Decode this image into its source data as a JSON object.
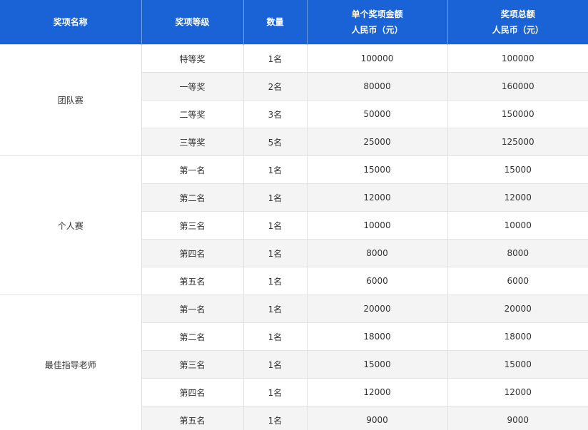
{
  "header": {
    "col1": "奖项名称",
    "col2": "奖项等级",
    "col3": "数量",
    "col4_line1": "单个奖项金额",
    "col4_line2": "人民币（元）",
    "col5_line1": "奖项总额",
    "col5_line2": "人民币（元）"
  },
  "groups": [
    {
      "name": "团队赛",
      "rows": [
        {
          "level": "特等奖",
          "count": "1名",
          "unit": "100000",
          "total": "100000"
        },
        {
          "level": "一等奖",
          "count": "2名",
          "unit": "80000",
          "total": "160000"
        },
        {
          "level": "二等奖",
          "count": "3名",
          "unit": "50000",
          "total": "150000"
        },
        {
          "level": "三等奖",
          "count": "5名",
          "unit": "25000",
          "total": "125000"
        }
      ]
    },
    {
      "name": "个人赛",
      "rows": [
        {
          "level": "第一名",
          "count": "1名",
          "unit": "15000",
          "total": "15000"
        },
        {
          "level": "第二名",
          "count": "1名",
          "unit": "12000",
          "total": "12000"
        },
        {
          "level": "第三名",
          "count": "1名",
          "unit": "10000",
          "total": "10000"
        },
        {
          "level": "第四名",
          "count": "1名",
          "unit": "8000",
          "total": "8000"
        },
        {
          "level": "第五名",
          "count": "1名",
          "unit": "6000",
          "total": "6000"
        }
      ]
    },
    {
      "name": "最佳指导老师",
      "rows": [
        {
          "level": "第一名",
          "count": "1名",
          "unit": "20000",
          "total": "20000"
        },
        {
          "level": "第二名",
          "count": "1名",
          "unit": "18000",
          "total": "18000"
        },
        {
          "level": "第三名",
          "count": "1名",
          "unit": "15000",
          "total": "15000"
        },
        {
          "level": "第四名",
          "count": "1名",
          "unit": "12000",
          "total": "12000"
        },
        {
          "level": "第五名",
          "count": "1名",
          "unit": "9000",
          "total": "9000"
        }
      ]
    }
  ],
  "colors": {
    "header_bg": "#1a63d6",
    "stripe": "#f4f4f4",
    "border": "#e3e3e3"
  }
}
